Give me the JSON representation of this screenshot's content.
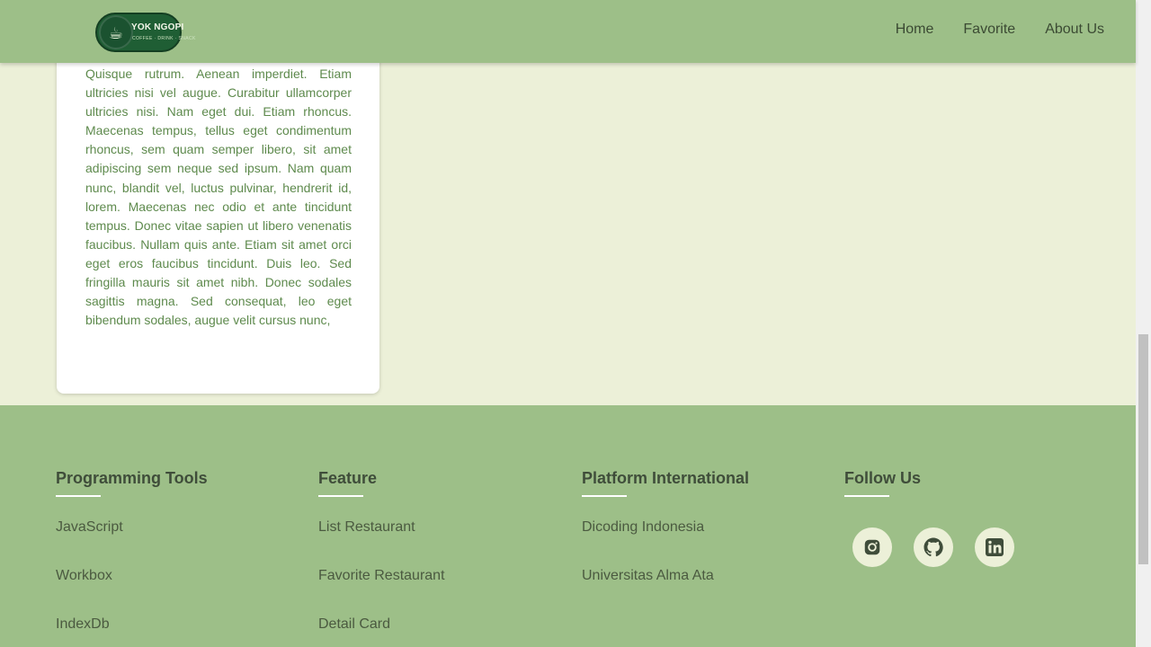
{
  "header": {
    "logo": {
      "name": "YOK NGOPI",
      "tagline": "COFFEE · DRINK · SNACK"
    },
    "nav": [
      {
        "label": "Home"
      },
      {
        "label": "Favorite"
      },
      {
        "label": "About Us"
      }
    ]
  },
  "card": {
    "text": "Quisque rutrum. Aenean imperdiet. Etiam ultricies nisi vel augue. Curabitur ullamcorper ultricies nisi. Nam eget dui. Etiam rhoncus. Maecenas tempus, tellus eget condimentum rhoncus, sem quam semper libero, sit amet adipiscing sem neque sed ipsum. Nam quam nunc, blandit vel, luctus pulvinar, hendrerit id, lorem. Maecenas nec odio et ante tincidunt tempus. Donec vitae sapien ut libero venenatis faucibus. Nullam quis ante. Etiam sit amet orci eget eros faucibus tincidunt. Duis leo. Sed fringilla mauris sit amet nibh. Donec sodales sagittis magna. Sed consequat, leo eget bibendum sodales, augue velit cursus nunc,"
  },
  "footer": {
    "columns": [
      {
        "title": "Programming Tools",
        "links": [
          "JavaScript",
          "Workbox",
          "IndexDb"
        ]
      },
      {
        "title": "Feature",
        "links": [
          "List Restaurant",
          "Favorite Restaurant",
          "Detail Card"
        ]
      },
      {
        "title": "Platform International",
        "links": [
          "Dicoding Indonesia",
          "Universitas Alma Ata"
        ]
      },
      {
        "title": "Follow Us",
        "links": []
      }
    ],
    "social": [
      {
        "icon": "instagram-icon"
      },
      {
        "icon": "github-icon"
      },
      {
        "icon": "linkedin-icon"
      }
    ]
  },
  "colors": {
    "header_bg": "#9dbf88",
    "page_bg": "#ecf0d8",
    "footer_bg": "#9dbf88",
    "card_text": "#5e8a4d"
  }
}
